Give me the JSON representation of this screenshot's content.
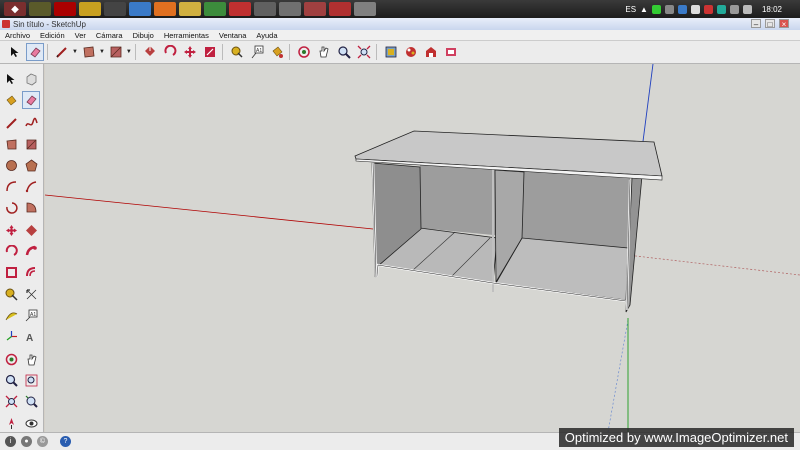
{
  "taskbar": {
    "apps": [
      "start-button",
      "app-2",
      "app-3",
      "app-4",
      "app-5",
      "app-6",
      "app-7",
      "app-8",
      "app-9",
      "app-10",
      "app-11",
      "app-12",
      "app-13",
      "app-14",
      "app-15",
      "app-16"
    ],
    "tray": {
      "language": "ES",
      "clock": "18:02"
    }
  },
  "window": {
    "title": "Sin título - SketchUp"
  },
  "menubar": [
    "Archivo",
    "Edición",
    "Ver",
    "Cámara",
    "Dibujo",
    "Herramientas",
    "Ventana",
    "Ayuda"
  ],
  "toolbar": {
    "tools": [
      "select-tool",
      "eraser-tool",
      "pencil-tool",
      "rectangle-tool",
      "shape-tool",
      "push-pull-tool",
      "rotate-tool",
      "move-tool",
      "scale-tool",
      "offset-tool",
      "tape-measure-tool",
      "text-tool",
      "paint-bucket-tool",
      "orbit-tool",
      "pan-tool",
      "zoom-tool",
      "zoom-extents-tool",
      "components-tool",
      "materials-tool",
      "warehouse-tool",
      "extension-tool"
    ]
  },
  "lefttoolbar": {
    "tools": [
      "select",
      "component",
      "paint",
      "eraser",
      "pencil",
      "freehand",
      "rectangle",
      "rotated-rectangle",
      "circle",
      "polygon",
      "arc",
      "pie",
      "two-point-arc",
      "three-point-arc",
      "move",
      "push-pull",
      "rotate",
      "follow-me",
      "scale",
      "offset",
      "tape-measure",
      "dimension",
      "protractor",
      "text",
      "axes",
      "3d-text",
      "orbit",
      "pan",
      "zoom",
      "zoom-window",
      "zoom-extents",
      "previous",
      "position-camera",
      "look-around"
    ]
  },
  "status": {
    "icons": [
      "credits-icon",
      "user-icon",
      "info-icon",
      "help-icon"
    ]
  },
  "watermark": "Optimized by www.ImageOptimizer.net",
  "colors": {
    "viewport_bg": "#d6d6d2",
    "red_axis": "#b00000",
    "green_axis": "#1e9e1e",
    "blue_axis": "#1f3fbf",
    "model_face": "#9a9a9a",
    "top_face": "#c8c8c8"
  }
}
